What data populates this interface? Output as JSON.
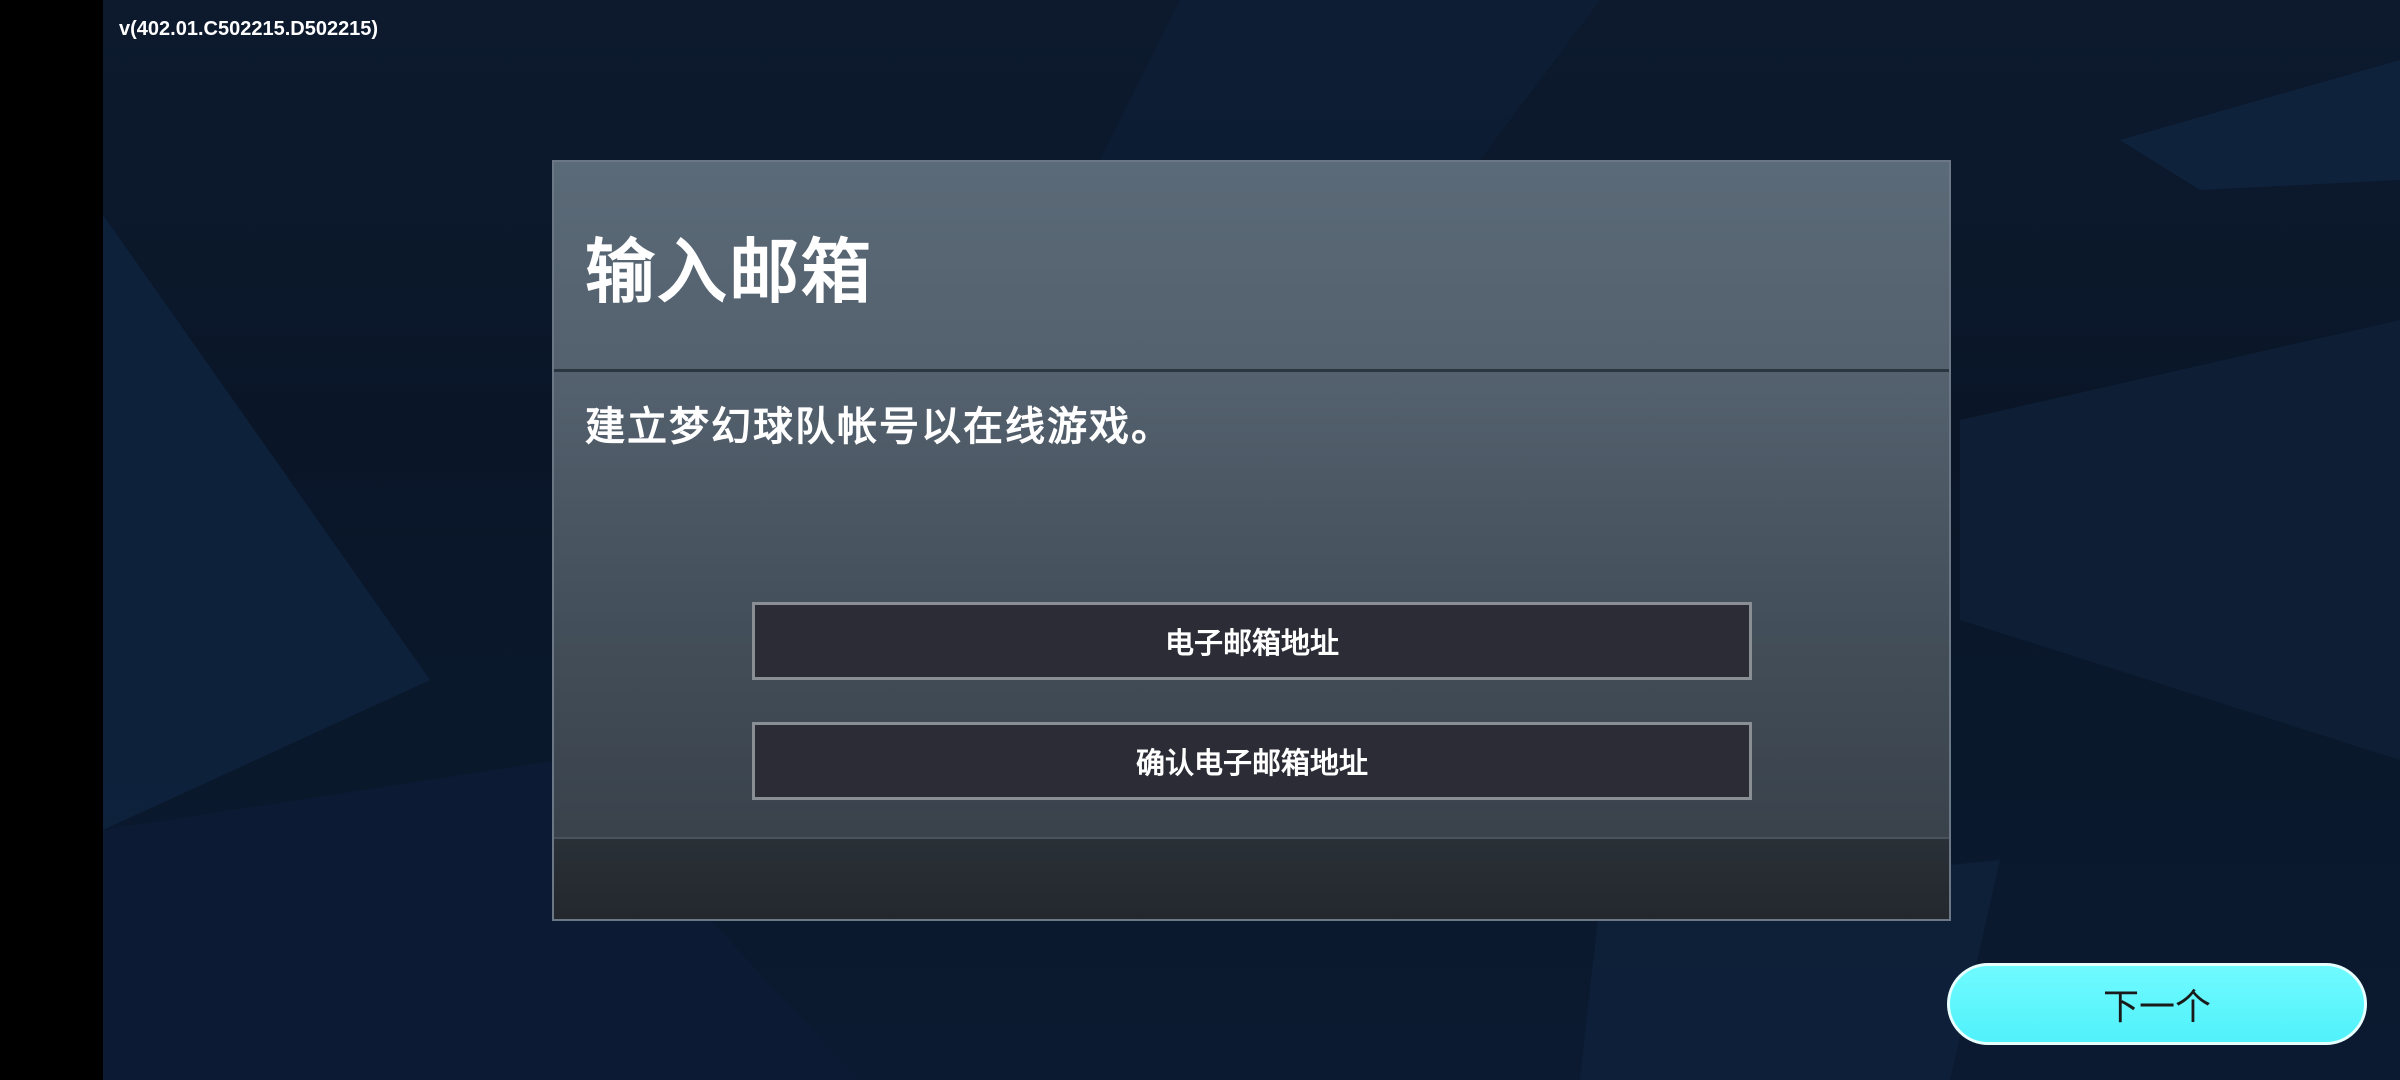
{
  "app": {
    "version": "v(402.01.C502215.D502215)"
  },
  "dialog": {
    "title": "输入邮箱",
    "subtitle": "建立梦幻球队帐号以在线游戏。",
    "email_placeholder": "电子邮箱地址",
    "confirm_email_placeholder": "确认电子邮箱地址"
  },
  "actions": {
    "next_label": "下一个"
  },
  "colors": {
    "accent": "#51f1fb",
    "background": "#0b1a30",
    "dialog": "#53606d",
    "field": "#2c2c36"
  }
}
